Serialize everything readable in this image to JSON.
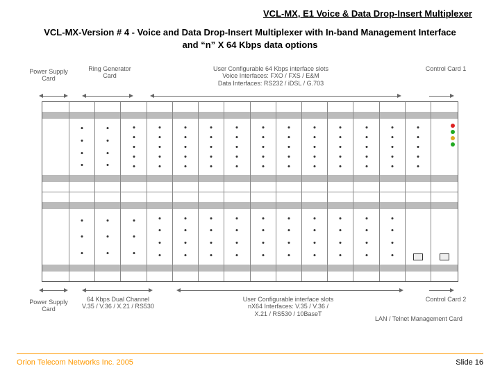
{
  "header": "VCL-MX, E1 Voice & Data Drop-Insert Multiplexer",
  "subtitle": "VCL-MX-Version # 4 - Voice and Data Drop-Insert Multiplexer with In-band Management Interface and “n” X 64 Kbps data options",
  "labels": {
    "psu_top": "Power Supply Card",
    "ring": "Ring Generator Card",
    "user_top_l1": "User Configurable 64 Kbps interface slots",
    "user_top_l2": "Voice Interfaces: FXO / FXS / E&M",
    "user_top_l3": "Data Interfaces: RS232 / iDSL / G.703",
    "ctrl1": "Control Card 1",
    "psu_bot": "Power Supply Card",
    "ch64_l1": "64 Kbps Dual Channel",
    "ch64_l2": "V.35 / V.36 / X.21 / RS530",
    "user_bot_l1": "User Configurable interface slots",
    "user_bot_l2": "nX64 Interfaces: V.35 / V.36 /",
    "user_bot_l3": "X.21 / RS530 / 10BaseT",
    "ctrl2": "Control Card 2",
    "lan": "LAN / Telnet Management Card"
  },
  "footer": {
    "company": "Orion Telecom Networks Inc. 2005",
    "slide": "Slide 16"
  }
}
